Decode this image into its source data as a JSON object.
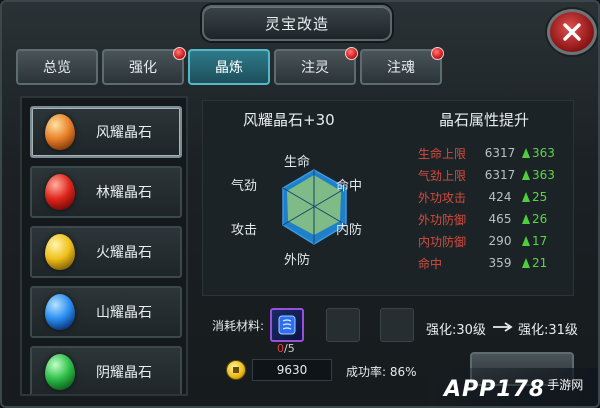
{
  "window": {
    "title": "灵宝改造"
  },
  "tabs": [
    {
      "label": "总览",
      "active": false,
      "dot": false
    },
    {
      "label": "强化",
      "active": false,
      "dot": true
    },
    {
      "label": "晶炼",
      "active": true,
      "dot": false
    },
    {
      "label": "注灵",
      "active": false,
      "dot": true
    },
    {
      "label": "注魂",
      "active": false,
      "dot": true
    }
  ],
  "crystals": [
    {
      "name": "风耀晶石",
      "color": "#e8802a",
      "selected": true
    },
    {
      "name": "林耀晶石",
      "color": "#e0261c",
      "selected": false
    },
    {
      "name": "火耀晶石",
      "color": "#f0c01a",
      "selected": false
    },
    {
      "name": "山耀晶石",
      "color": "#2a8ef0",
      "selected": false
    },
    {
      "name": "阴耀晶石",
      "color": "#2fbf4a",
      "selected": false
    }
  ],
  "radar": {
    "title": "风耀晶石+30",
    "labels": {
      "top": "生命",
      "top_right": "命中",
      "bottom_right": "内防",
      "bottom": "外防",
      "bottom_left": "攻击",
      "top_left": "气劲"
    }
  },
  "attributes": {
    "title": "晶石属性提升",
    "rows": [
      {
        "name": "生命上限",
        "value": "6317",
        "bonus": "363"
      },
      {
        "name": "气劲上限",
        "value": "6317",
        "bonus": "363"
      },
      {
        "name": "外功攻击",
        "value": "424",
        "bonus": "25"
      },
      {
        "name": "外功防御",
        "value": "465",
        "bonus": "26"
      },
      {
        "name": "内功防御",
        "value": "290",
        "bonus": "17"
      },
      {
        "name": "命中",
        "value": "359",
        "bonus": "21"
      }
    ]
  },
  "materials": {
    "label": "消耗材料:",
    "have": "0",
    "separator": "/",
    "need": "5"
  },
  "level": {
    "current": "强化:30级",
    "next": "强化:31级"
  },
  "cost": {
    "amount": "9630"
  },
  "success_rate": "成功率: 86%",
  "watermark": {
    "brand": "APP178",
    "sub": "手游网"
  },
  "colors": {
    "accent_tab": "#2e7a8a",
    "attr_name": "#d24c3e",
    "up": "#4fcf3c"
  }
}
